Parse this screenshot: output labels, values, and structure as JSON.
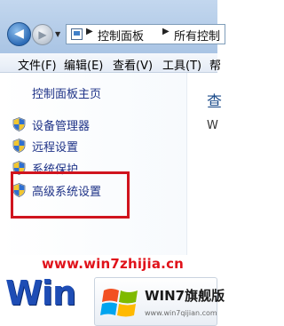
{
  "window": {
    "breadcrumbs": [
      "控制面板",
      "所有控制"
    ]
  },
  "menu": {
    "items": [
      "文件(F)",
      "编辑(E)",
      "查看(V)",
      "工具(T)",
      "帮"
    ]
  },
  "left_pane": {
    "home_link": "控制面板主页",
    "tasks": [
      {
        "label": "设备管理器",
        "icon": "shield-icon"
      },
      {
        "label": "远程设置",
        "icon": "shield-icon"
      },
      {
        "label": "系统保护",
        "icon": "shield-icon"
      },
      {
        "label": "高级系统设置",
        "icon": "shield-icon"
      }
    ]
  },
  "content": {
    "title": "查",
    "text": "W"
  },
  "annotation": {
    "color": "#d0141e"
  },
  "watermark": {
    "url": "www.win7zhijia.cn",
    "logo_text": "Win",
    "badge_title": "WIN7旗舰版",
    "badge_url": "www.win7qijian.com"
  }
}
